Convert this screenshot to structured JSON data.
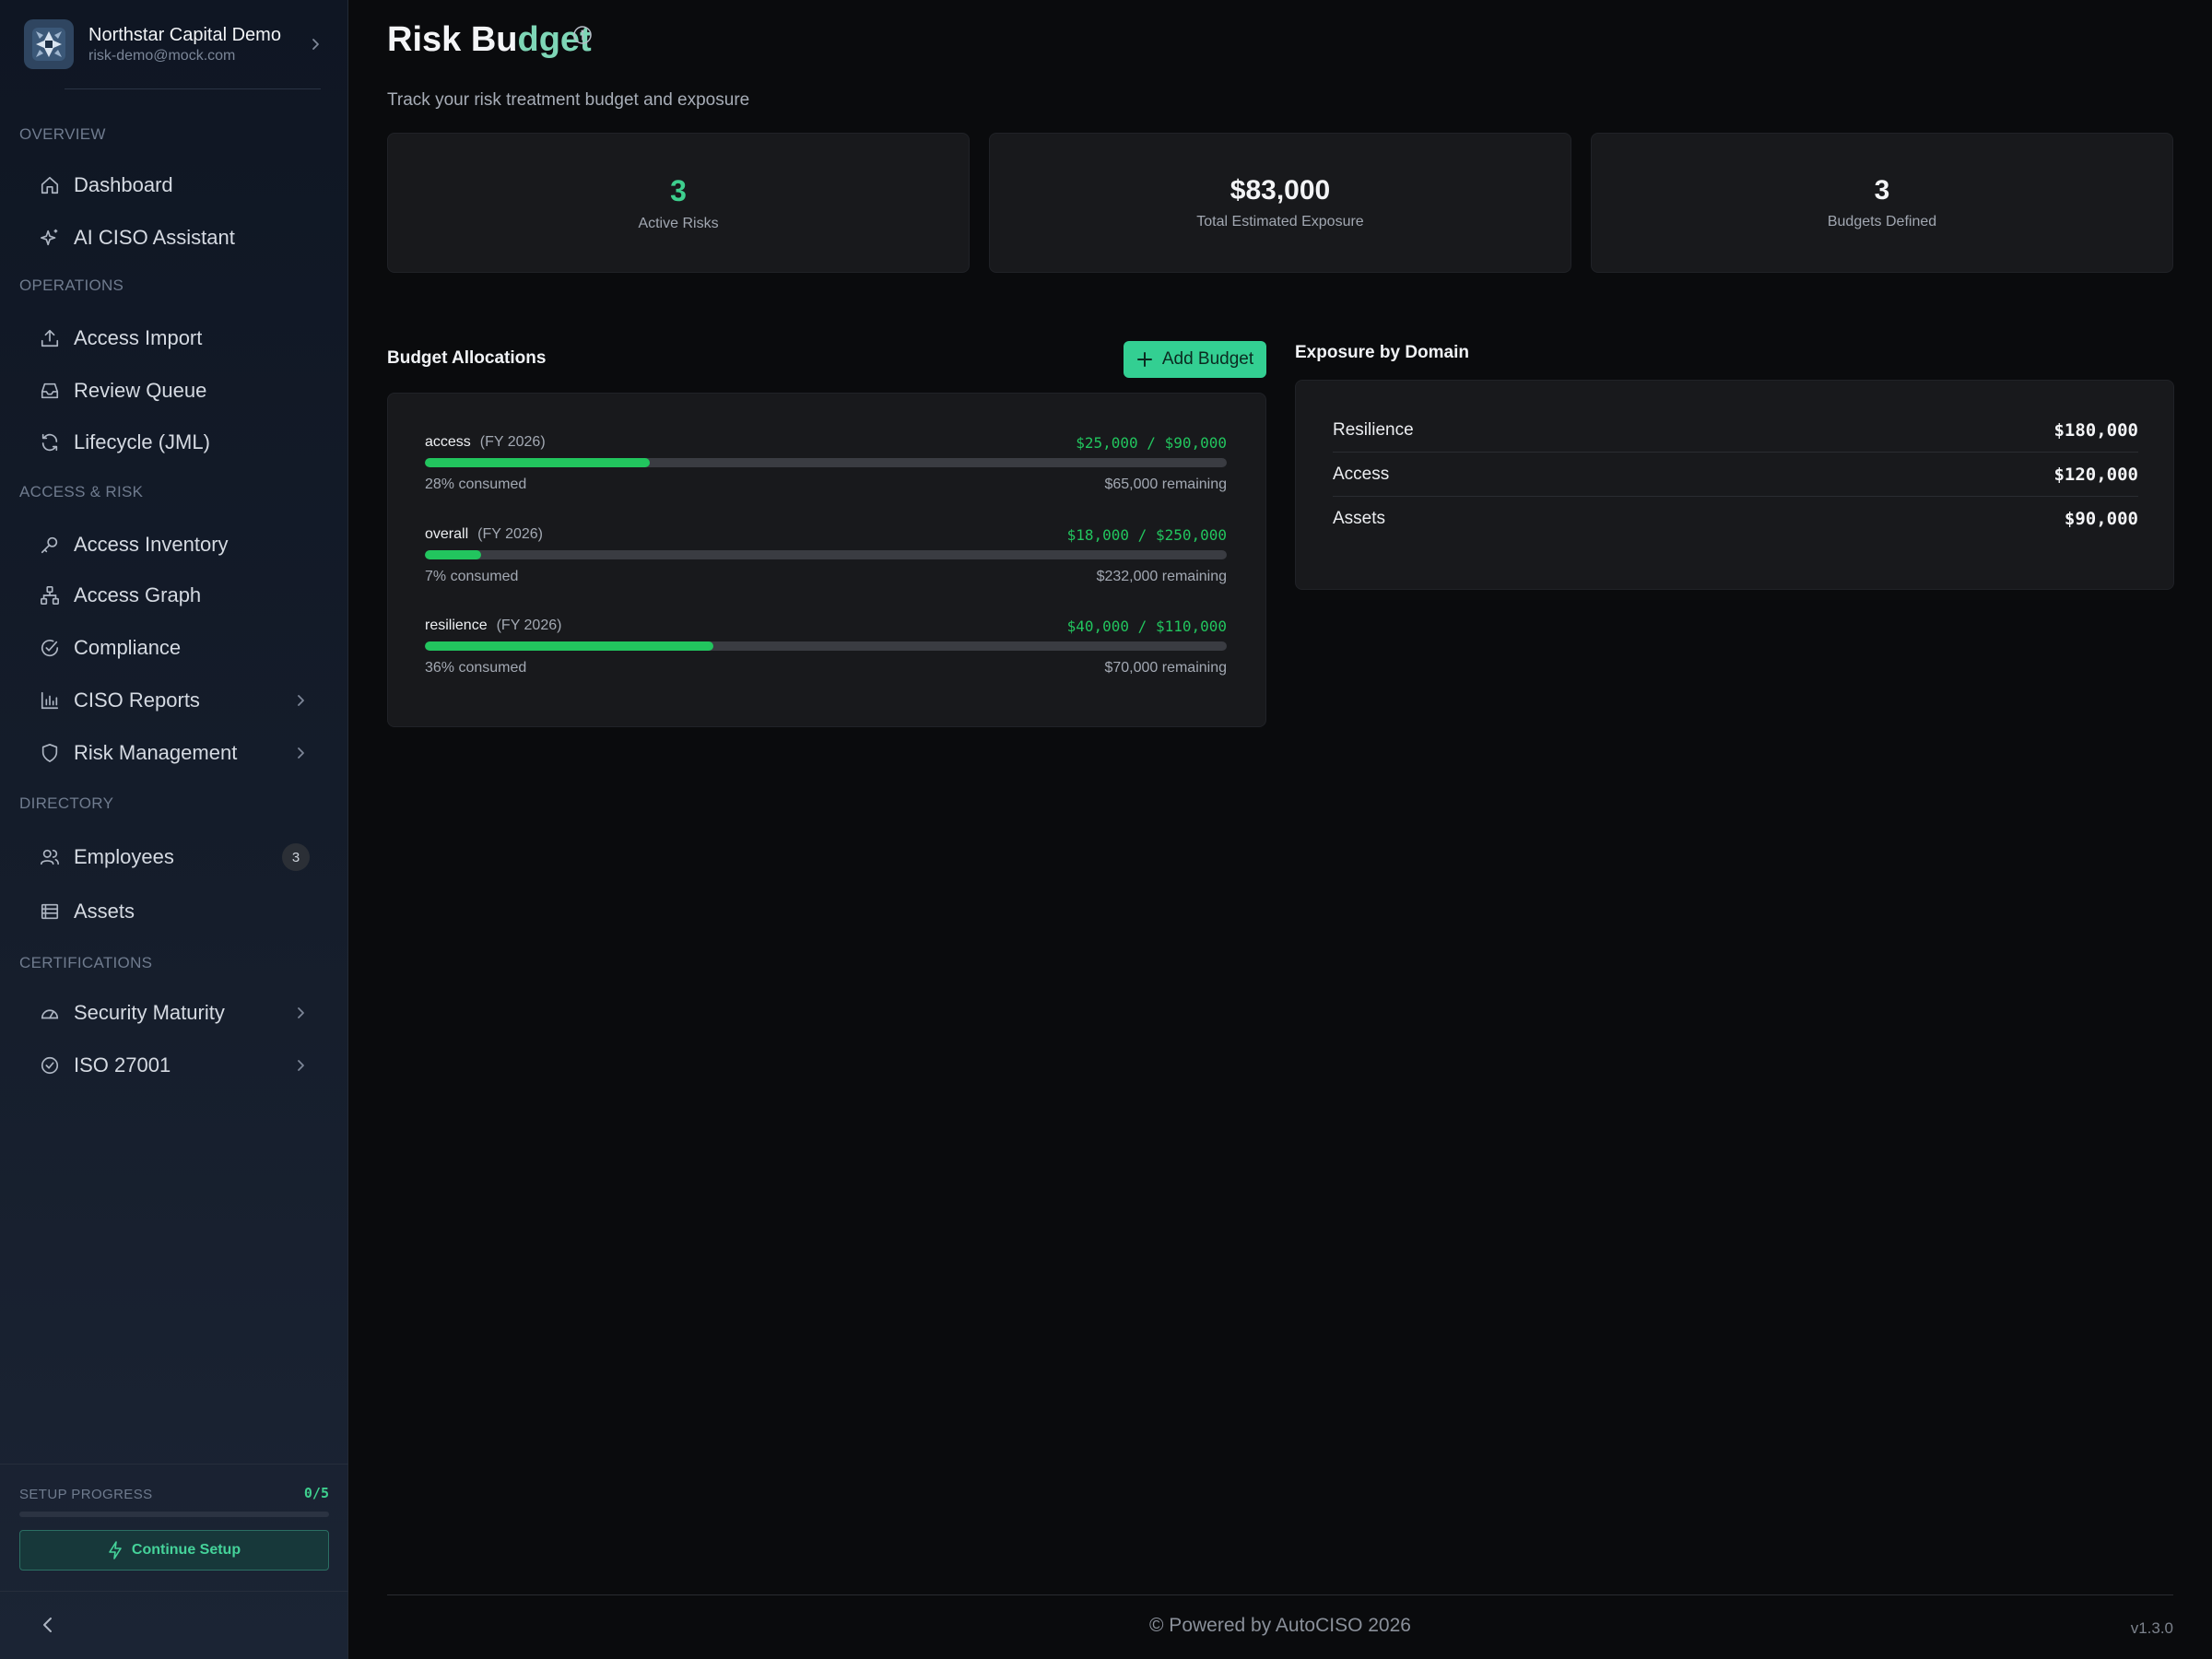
{
  "org": {
    "name": "Northstar Capital Demo",
    "email": "risk-demo@mock.com"
  },
  "sidebar": {
    "sections": [
      {
        "label": "OVERVIEW"
      },
      {
        "label": "OPERATIONS"
      },
      {
        "label": "ACCESS & RISK"
      },
      {
        "label": "DIRECTORY"
      },
      {
        "label": "CERTIFICATIONS"
      }
    ],
    "items": [
      {
        "label": "Dashboard",
        "icon": "home-icon"
      },
      {
        "label": "AI CISO Assistant",
        "icon": "sparkles-icon"
      },
      {
        "label": "Access Import",
        "icon": "upload-icon"
      },
      {
        "label": "Review Queue",
        "icon": "inbox-icon"
      },
      {
        "label": "Lifecycle (JML)",
        "icon": "refresh-icon"
      },
      {
        "label": "Access Inventory",
        "icon": "key-icon"
      },
      {
        "label": "Access Graph",
        "icon": "network-icon"
      },
      {
        "label": "Compliance",
        "icon": "check-circle-icon"
      },
      {
        "label": "CISO Reports",
        "icon": "bar-chart-icon",
        "has_submenu": true
      },
      {
        "label": "Risk Management",
        "icon": "shield-icon",
        "has_submenu": true
      },
      {
        "label": "Employees",
        "icon": "users-icon",
        "badge": "3"
      },
      {
        "label": "Assets",
        "icon": "server-icon"
      },
      {
        "label": "Security Maturity",
        "icon": "gauge-icon",
        "has_submenu": true
      },
      {
        "label": "ISO 27001",
        "icon": "badge-check-icon",
        "has_submenu": true
      }
    ],
    "setup": {
      "label": "SETUP PROGRESS",
      "count": "0/5",
      "progress": 0,
      "button_label": "Continue Setup"
    }
  },
  "page": {
    "title_part1": "Risk Bu",
    "title_part2": "dget",
    "subtitle": "Track your risk treatment budget and exposure"
  },
  "stats": [
    {
      "value": "3",
      "label": "Active Risks"
    },
    {
      "value": "$83,000",
      "label": "Total Estimated Exposure"
    },
    {
      "value": "3",
      "label": "Budgets Defined"
    }
  ],
  "budget_section": {
    "title": "Budget Allocations",
    "add_label": "Add Budget",
    "rows": [
      {
        "name": "access",
        "fy": "(FY 2026)",
        "amount": "$25,000 / $90,000",
        "percent": 28,
        "consumed": "28% consumed",
        "remaining": "$65,000 remaining"
      },
      {
        "name": "overall",
        "fy": "(FY 2026)",
        "amount": "$18,000 / $250,000",
        "percent": 7,
        "consumed": "7% consumed",
        "remaining": "$232,000 remaining"
      },
      {
        "name": "resilience",
        "fy": "(FY 2026)",
        "amount": "$40,000 / $110,000",
        "percent": 36,
        "consumed": "36% consumed",
        "remaining": "$70,000 remaining"
      }
    ]
  },
  "exposure_section": {
    "title": "Exposure by Domain",
    "rows": [
      {
        "name": "Resilience",
        "value": "$180,000"
      },
      {
        "name": "Access",
        "value": "$120,000"
      },
      {
        "name": "Assets",
        "value": "$90,000"
      }
    ]
  },
  "footer": {
    "text": "© Powered by AutoCISO 2026",
    "version": "v1.3.0"
  },
  "colors": {
    "accent": "#3ecf8e",
    "progress": "#22c55e",
    "background": "#0a0b0d"
  }
}
